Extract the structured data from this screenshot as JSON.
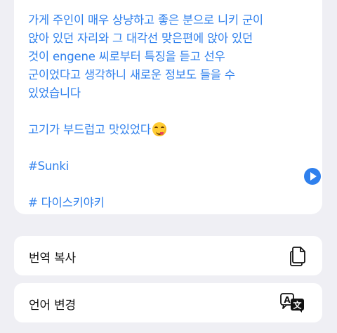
{
  "translation": {
    "lines": [
      "가게 주인이 매우 상냥하고 좋은 분으로 니키 군이",
      "앉아 있던 자리와 그 대각선 맞은편에 앉아 있던",
      "것이 engene 씨로부터 특징을 듣고 선우",
      "군이었다고 생각하니 새로운 정보도 들을 수",
      "있었습니다"
    ],
    "tasty_line": "고기가 부드럽고 맛있었다",
    "hashtag_1": "#Sunki",
    "hashtag_2": "# 다이스키야키"
  },
  "actions": {
    "copy_translation_label": "번역 복사",
    "change_language_label": "언어 변경"
  },
  "icons": {
    "play": "play-icon",
    "copy": "copy-icon",
    "language": "translate-icon",
    "emoji": "yummy-face-emoji"
  },
  "colors": {
    "accent": "#2f80ed",
    "background": "#efeff4",
    "card": "#ffffff"
  }
}
